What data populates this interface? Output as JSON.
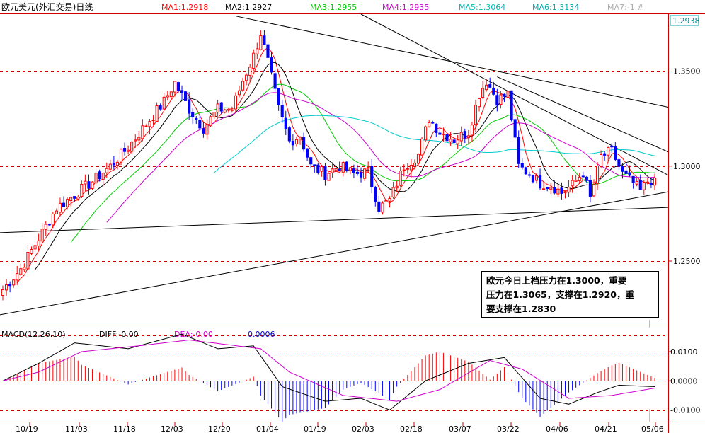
{
  "header": {
    "title": "欧元美元(外汇交易)日线",
    "ma_labels": [
      {
        "text": "MA1:1.2918",
        "color": "#ff0000"
      },
      {
        "text": "MA2:1.2927",
        "color": "#000000"
      },
      {
        "text": "MA3:1.2955",
        "color": "#00cc00"
      },
      {
        "text": "MA4:1.2935",
        "color": "#cc00cc"
      },
      {
        "text": "MA5:1.3064",
        "color": "#00bbbb"
      },
      {
        "text": "MA6:1.3134",
        "color": "#00aaaa"
      },
      {
        "text": "MA7:-1.#",
        "color": "#aaaaaa"
      }
    ]
  },
  "price_axis": {
    "current_price": "1.2938",
    "ticks": [
      "1.3500",
      "1.3000",
      "1.2500"
    ]
  },
  "macd_header": {
    "name": "MACD(12,26,10)",
    "diff": "DIFF:-0.00",
    "dea": "DEA:-0.00",
    "macd": "0.0006"
  },
  "macd_axis": {
    "ticks": [
      "0.0100",
      "0.0000",
      "-0.0100"
    ]
  },
  "annotation": {
    "lines": [
      "欧元今日上档压力在1.3000，重要",
      "压力在1.3065，支撑在1.2920，重",
      "要支撑在1.2830"
    ]
  },
  "colors": {
    "up": "#ff0000",
    "down": "#0000ff",
    "grid": "#cc0000",
    "ma1": "#ff0000",
    "ma2": "#000000",
    "ma3": "#00cc00",
    "ma4": "#cc00cc",
    "ma5": "#00cccc",
    "diff": "#000000",
    "dea": "#cc00cc"
  },
  "chart_data": [
    {
      "type": "candlestick",
      "title": "欧元美元(外汇交易)日线",
      "x_labels": [
        "10/19",
        "11/03",
        "11/18",
        "12/03",
        "12/20",
        "01/04",
        "01/19",
        "02/03",
        "02/18",
        "03/07",
        "03/22",
        "04/06",
        "04/21",
        "05/06"
      ],
      "ylim": [
        1.215,
        1.38
      ],
      "y_ticks": [
        1.25,
        1.3,
        1.35
      ],
      "last_price": 1.2938,
      "close_keypoints": [
        {
          "bar": 0,
          "close": 1.235
        },
        {
          "bar": 5,
          "close": 1.246
        },
        {
          "bar": 10,
          "close": 1.262
        },
        {
          "bar": 15,
          "close": 1.278
        },
        {
          "bar": 20,
          "close": 1.285
        },
        {
          "bar": 25,
          "close": 1.292
        },
        {
          "bar": 30,
          "close": 1.3
        },
        {
          "bar": 35,
          "close": 1.31
        },
        {
          "bar": 40,
          "close": 1.322
        },
        {
          "bar": 45,
          "close": 1.334
        },
        {
          "bar": 48,
          "close": 1.344
        },
        {
          "bar": 52,
          "close": 1.33
        },
        {
          "bar": 56,
          "close": 1.32
        },
        {
          "bar": 60,
          "close": 1.33
        },
        {
          "bar": 64,
          "close": 1.33
        },
        {
          "bar": 67,
          "close": 1.345
        },
        {
          "bar": 70,
          "close": 1.358
        },
        {
          "bar": 72,
          "close": 1.37
        },
        {
          "bar": 74,
          "close": 1.355
        },
        {
          "bar": 77,
          "close": 1.33
        },
        {
          "bar": 80,
          "close": 1.313
        },
        {
          "bar": 83,
          "close": 1.316
        },
        {
          "bar": 86,
          "close": 1.3
        },
        {
          "bar": 90,
          "close": 1.296
        },
        {
          "bar": 94,
          "close": 1.3
        },
        {
          "bar": 98,
          "close": 1.296
        },
        {
          "bar": 102,
          "close": 1.297
        },
        {
          "bar": 105,
          "close": 1.278
        },
        {
          "bar": 108,
          "close": 1.282
        },
        {
          "bar": 112,
          "close": 1.3
        },
        {
          "bar": 116,
          "close": 1.306
        },
        {
          "bar": 119,
          "close": 1.325
        },
        {
          "bar": 122,
          "close": 1.318
        },
        {
          "bar": 126,
          "close": 1.314
        },
        {
          "bar": 130,
          "close": 1.318
        },
        {
          "bar": 133,
          "close": 1.338
        },
        {
          "bar": 135,
          "close": 1.345
        },
        {
          "bar": 138,
          "close": 1.335
        },
        {
          "bar": 141,
          "close": 1.338
        },
        {
          "bar": 144,
          "close": 1.3
        },
        {
          "bar": 147,
          "close": 1.296
        },
        {
          "bar": 150,
          "close": 1.291
        },
        {
          "bar": 153,
          "close": 1.29
        },
        {
          "bar": 156,
          "close": 1.286
        },
        {
          "bar": 159,
          "close": 1.29
        },
        {
          "bar": 162,
          "close": 1.297
        },
        {
          "bar": 164,
          "close": 1.283
        },
        {
          "bar": 167,
          "close": 1.305
        },
        {
          "bar": 170,
          "close": 1.308
        },
        {
          "bar": 173,
          "close": 1.296
        },
        {
          "bar": 176,
          "close": 1.291
        },
        {
          "bar": 178,
          "close": 1.287
        },
        {
          "bar": 180,
          "close": 1.292
        },
        {
          "bar": 182,
          "close": 1.2938
        }
      ]
    },
    {
      "type": "macd",
      "title": "MACD(12,26,10)",
      "ylim": [
        -0.014,
        0.018
      ],
      "y_ticks": [
        0.01,
        0.0,
        -0.01
      ],
      "diff_keypoints": [
        {
          "bar": 0,
          "value": 0.0
        },
        {
          "bar": 10,
          "value": 0.006
        },
        {
          "bar": 20,
          "value": 0.013
        },
        {
          "bar": 35,
          "value": 0.011
        },
        {
          "bar": 50,
          "value": 0.016
        },
        {
          "bar": 60,
          "value": 0.011
        },
        {
          "bar": 70,
          "value": 0.012
        },
        {
          "bar": 78,
          "value": -0.002
        },
        {
          "bar": 90,
          "value": -0.007
        },
        {
          "bar": 100,
          "value": -0.006
        },
        {
          "bar": 108,
          "value": -0.01
        },
        {
          "bar": 118,
          "value": 0.0
        },
        {
          "bar": 130,
          "value": 0.006
        },
        {
          "bar": 140,
          "value": 0.008
        },
        {
          "bar": 150,
          "value": -0.006
        },
        {
          "bar": 158,
          "value": -0.008
        },
        {
          "bar": 166,
          "value": -0.004
        },
        {
          "bar": 172,
          "value": -0.0015
        },
        {
          "bar": 182,
          "value": -0.002
        }
      ],
      "dea_keypoints": [
        {
          "bar": 0,
          "value": 0.0
        },
        {
          "bar": 10,
          "value": 0.003
        },
        {
          "bar": 22,
          "value": 0.01
        },
        {
          "bar": 38,
          "value": 0.012
        },
        {
          "bar": 52,
          "value": 0.014
        },
        {
          "bar": 72,
          "value": 0.011
        },
        {
          "bar": 80,
          "value": 0.003
        },
        {
          "bar": 95,
          "value": -0.005
        },
        {
          "bar": 110,
          "value": -0.007
        },
        {
          "bar": 122,
          "value": -0.003
        },
        {
          "bar": 136,
          "value": 0.007
        },
        {
          "bar": 145,
          "value": 0.004
        },
        {
          "bar": 158,
          "value": -0.006
        },
        {
          "bar": 170,
          "value": -0.005
        },
        {
          "bar": 182,
          "value": -0.0025
        }
      ]
    }
  ]
}
